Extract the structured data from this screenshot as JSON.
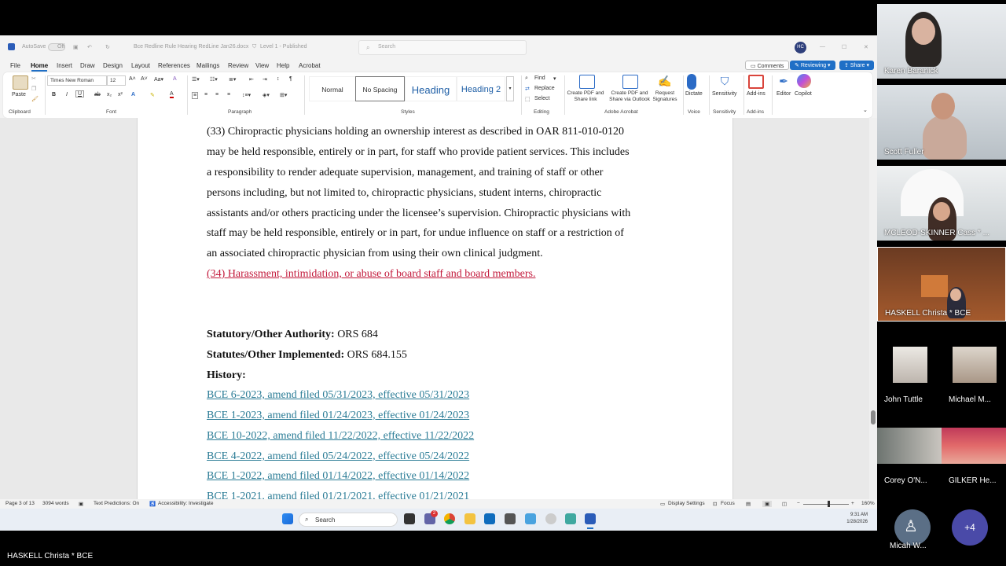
{
  "titlebar": {
    "autosave": "AutoSave",
    "autosave_state": "Off",
    "doc_name": "Bce Redline Rule Hearing RedLine Jan26.docx",
    "level": "Level 1 - Published",
    "search_placeholder": "Search",
    "avatar_initials": "HC"
  },
  "menu": {
    "items": [
      "File",
      "Home",
      "Insert",
      "Draw",
      "Design",
      "Layout",
      "References",
      "Mailings",
      "Review",
      "View",
      "Help",
      "Acrobat"
    ],
    "comments": "Comments",
    "reviewing": "Reviewing",
    "share": "Share"
  },
  "ribbon": {
    "paste": "Paste",
    "font_name": "Times New Roman",
    "font_size": "12",
    "styles": [
      "Normal",
      "No Spacing",
      "Heading",
      "Heading 2"
    ],
    "find": "Find",
    "replace": "Replace",
    "select": "Select",
    "acrobat_btn1": "Create PDF and Share link",
    "acrobat_btn2": "Create PDF and Share via Outlook",
    "acrobat_btn3": "Request Signatures",
    "dictate": "Dictate",
    "sensitivity": "Sensitivity",
    "addins": "Add-ins",
    "editor": "Editor",
    "copilot": "Copilot",
    "groups": {
      "clipboard": "Clipboard",
      "font": "Font",
      "paragraph": "Paragraph",
      "styles": "Styles",
      "editing": "Editing",
      "adobe": "Adobe Acrobat",
      "voice": "Voice",
      "sensitivity": "Sensitivity",
      "addins": "Add-ins"
    }
  },
  "document": {
    "para33": [
      "(33) Chiropractic physicians holding an ownership interest as described in OAR 811-010-0120",
      "may be held responsible, entirely or in part, for staff who provide patient services. This includes",
      "a responsibility to render adequate supervision, management, and training of staff or other",
      "persons including, but not limited to, chiropractic physicians, student interns, chiropractic",
      "assistants and/or others practicing under the licensee’s supervision. Chiropractic physicians with",
      "staff may be held responsible, entirely or in part, for undue influence on staff or a restriction of",
      "an associated chiropractic physician from using their own clinical judgment."
    ],
    "para34": "(34) Harassment, intimidation, or abuse of board staff and board members.",
    "statutory_label": "Statutory/Other Authority:",
    "statutory_value": " ORS 684",
    "implemented_label": "Statutes/Other Implemented:",
    "implemented_value": " ORS 684.155",
    "history_label": "History:",
    "history": [
      "BCE 6-2023, amend filed 05/31/2023, effective 05/31/2023",
      "BCE 1-2023, amend filed 01/24/2023, effective 01/24/2023",
      "BCE 10-2022, amend filed 11/22/2022, effective 11/22/2022",
      "BCE 4-2022, amend filed 05/24/2022, effective 05/24/2022",
      "BCE 1-2022, amend filed 01/14/2022, effective 01/14/2022",
      "BCE 1-2021, amend filed 01/21/2021, effective 01/21/2021"
    ]
  },
  "status": {
    "page": "Page 3 of 13",
    "words": "3094 words",
    "predictions": "Text Predictions: On",
    "accessibility": "Accessibility: Investigate",
    "display": "Display Settings",
    "focus": "Focus",
    "zoom": "160%"
  },
  "taskbar": {
    "search": "Search",
    "notification_count": "2",
    "time": "9:31 AM",
    "date": "1/28/2026"
  },
  "participants": [
    {
      "name": "Karen Baranick"
    },
    {
      "name": "Scott Fuller"
    },
    {
      "name": "MCLEOD-SKINNER Cass * ..."
    },
    {
      "name": "HASKELL Christa * BCE"
    },
    {
      "name": "John Tuttle"
    },
    {
      "name": "Michael M..."
    },
    {
      "name": "Corey O'N..."
    },
    {
      "name": "GILKER He..."
    },
    {
      "name": "Micah W..."
    }
  ],
  "more_participants": "+4",
  "active_speaker": "HASKELL Christa * BCE",
  "colors": {
    "tracked_insert": "#c2183a",
    "history_link": "#2b7c96",
    "accent": "#1f6fc6"
  }
}
